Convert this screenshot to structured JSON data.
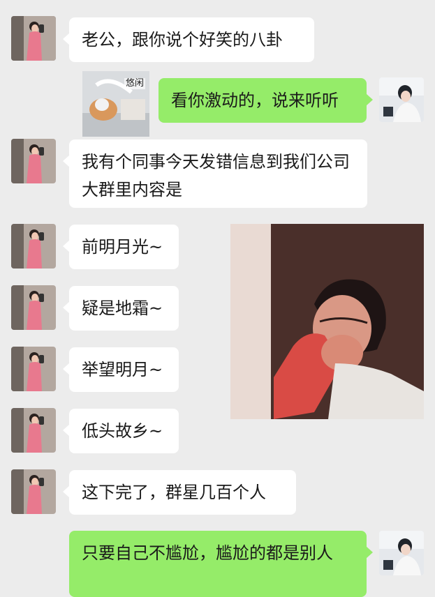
{
  "messages": [
    {
      "side": "left",
      "text": "老公，跟你说个好笑的八卦"
    },
    {
      "side": "right",
      "text": "看你激动的，说来听听"
    },
    {
      "side": "left",
      "text": "我有个同事今天发错信息到我们公司大群里内容是"
    },
    {
      "side": "left",
      "text": "前明月光~"
    },
    {
      "side": "left",
      "text": "疑是地霜~"
    },
    {
      "side": "left",
      "text": "举望明月~"
    },
    {
      "side": "left",
      "text": "低头故乡~"
    },
    {
      "side": "left",
      "text": "这下完了，群星几百个人"
    },
    {
      "side": "right",
      "text": "只要自己不尴尬，尴尬的都是别人"
    }
  ],
  "sticker_small": {
    "caption": "悠闲",
    "icon": "lounging-pet-sticker"
  },
  "sticker_large": {
    "icon": "crying-girl-photo"
  },
  "avatars": {
    "left": "woman-in-pink-dress-avatar",
    "right": "man-in-car-avatar"
  },
  "colors": {
    "background": "#ececec",
    "incoming_bubble": "#ffffff",
    "outgoing_bubble": "#95ec69"
  }
}
